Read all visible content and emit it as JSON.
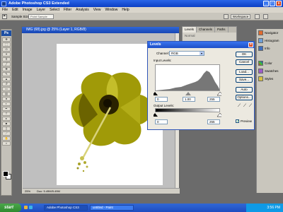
{
  "window": {
    "title": "Adobe Photoshop CS3 Extended",
    "buttons": [
      "_",
      "□",
      "x"
    ]
  },
  "menu": [
    "File",
    "Edit",
    "Image",
    "Layer",
    "Select",
    "Filter",
    "Analysis",
    "View",
    "Window",
    "Help"
  ],
  "options": {
    "sample_size_label": "Sample Size:",
    "sample_size_value": "Point Sample",
    "workspace": "Workspace"
  },
  "toolbox": {
    "logo": "Ps"
  },
  "document": {
    "title": "IMG (68).jpg @ 25% (Layer 1, RGB/8)",
    "zoom": "25%",
    "doc_info": "Doc: 5.49M/5.49M"
  },
  "layers_panel": {
    "tabs": [
      "Levels",
      "Channels",
      "Paths"
    ],
    "mode": "Normal"
  },
  "dock": {
    "top": [
      "Navigator",
      "Histogram",
      "Info"
    ],
    "bottom": [
      "Color",
      "Swatches",
      "Styles"
    ]
  },
  "levels": {
    "title": "Levels",
    "close": "x",
    "channel_label": "Channel:",
    "channel_value": "RGB",
    "input_label": "Input Levels:",
    "input_values": [
      "0",
      "1.00",
      "255"
    ],
    "output_label": "Output Levels:",
    "output_values": [
      "0",
      "255"
    ],
    "buttons": [
      "OK",
      "Cancel",
      "Load...",
      "Save...",
      "Auto",
      "Options..."
    ],
    "preview_label": "Preview",
    "preview_checked": true
  },
  "taskbar": {
    "start": "start",
    "tasks": [
      "Adobe Photoshop CS3",
      "untitled - Paint"
    ],
    "clock": "3:56 PM"
  },
  "colors": {
    "flower": "#9a9200",
    "flower_dark": "#2a2200",
    "xp_blue": "#1d4fc8"
  }
}
